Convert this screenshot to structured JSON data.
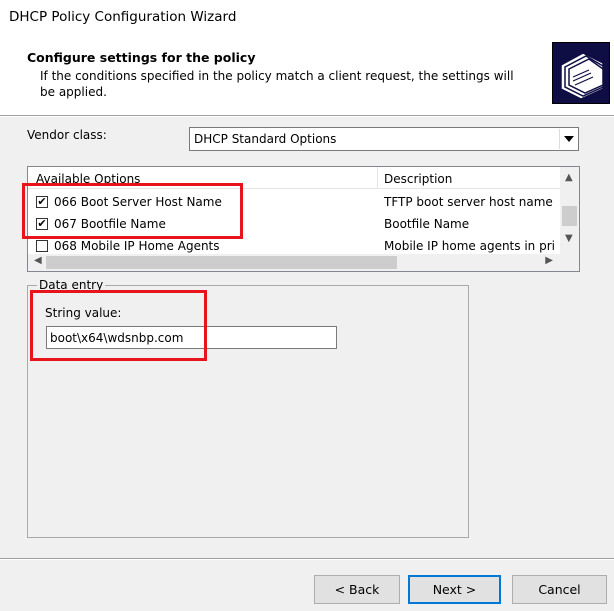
{
  "window": {
    "title": "DHCP Policy Configuration Wizard"
  },
  "header": {
    "title": "Configure settings for the policy",
    "subtitle": "If the conditions specified in the policy match a client request, the settings will be applied.",
    "icon": "wizard-folders-icon"
  },
  "vendor": {
    "label": "Vendor class:",
    "selected": "DHCP Standard Options"
  },
  "options_list": {
    "columns": [
      "Available Options",
      "Description"
    ],
    "rows": [
      {
        "checked": true,
        "name": "066 Boot Server Host Name",
        "description": "TFTP boot server host name"
      },
      {
        "checked": true,
        "name": "067 Bootfile Name",
        "description": "Bootfile Name"
      },
      {
        "checked": false,
        "name": "068 Mobile IP Home Agents",
        "description": "Mobile IP home agents in pri"
      }
    ]
  },
  "data_entry": {
    "legend": "Data entry",
    "string_label": "String value:",
    "string_value": "boot\\x64\\wdsnbp.com"
  },
  "buttons": {
    "back": "< Back",
    "next": "Next >",
    "cancel": "Cancel"
  },
  "colors": {
    "highlight": "#e8141c",
    "accent": "#0078d7"
  }
}
